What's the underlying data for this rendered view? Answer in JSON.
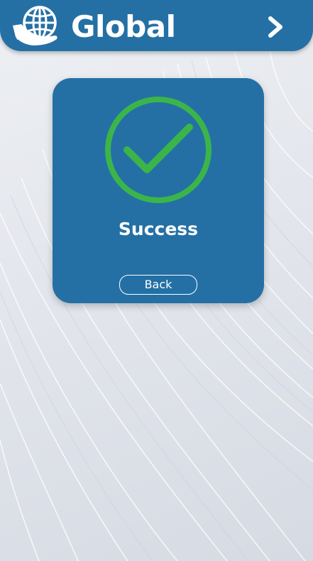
{
  "header": {
    "logo_icon": "globe-handshake-icon",
    "title": "Global",
    "next_icon": "chevron-right-icon"
  },
  "card": {
    "status_icon": "check-circle-icon",
    "status_text": "Success",
    "back_label": "Back"
  },
  "colors": {
    "brand_blue": "#2470a5",
    "success_green": "#3bb54a",
    "text_white": "#ffffff"
  }
}
